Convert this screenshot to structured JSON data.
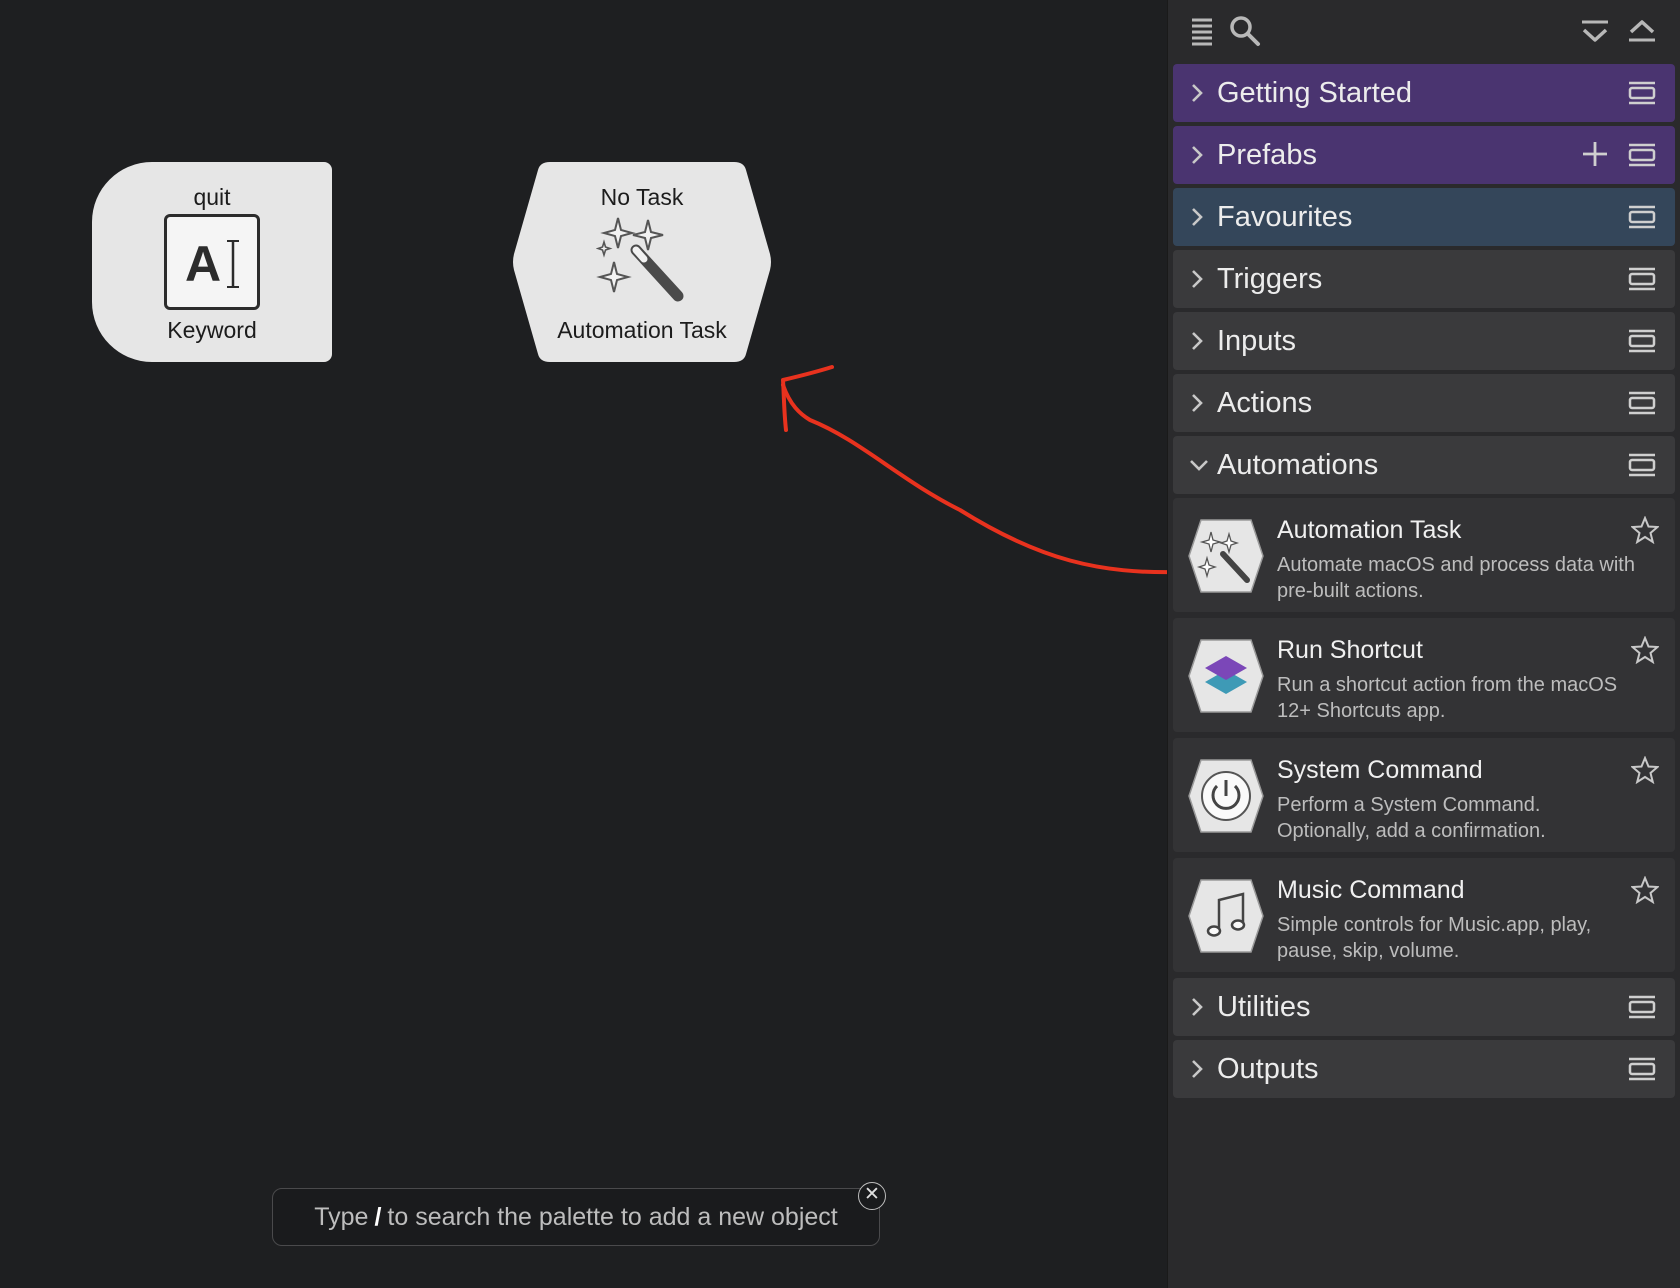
{
  "canvas": {
    "keyword_node": {
      "top_label": "quit",
      "bottom_label": "Keyword",
      "icon": "keyword-icon"
    },
    "task_node": {
      "top_label": "No Task",
      "bottom_label": "Automation Task",
      "icon": "magic-wand-icon"
    },
    "hint": {
      "prefix": "Type",
      "key": "/",
      "suffix": "to search the palette to add a new object"
    }
  },
  "sidebar": {
    "toolbar": {
      "left_icons": [
        "list-icon",
        "search-icon"
      ],
      "right_icons": [
        "collapse-all-icon",
        "expand-up-icon"
      ]
    },
    "sections_top": [
      {
        "label": "Getting Started",
        "color": "#4a3470"
      },
      {
        "label": "Prefabs",
        "color": "#4a3470",
        "has_add": true
      },
      {
        "label": "Favourites",
        "color": "#34465a"
      },
      {
        "label": "Triggers"
      },
      {
        "label": "Inputs"
      },
      {
        "label": "Actions"
      },
      {
        "label": "Automations",
        "expanded": true
      }
    ],
    "automation_items": [
      {
        "title": "Automation Task",
        "desc": "Automate macOS and process data with pre-built actions.",
        "icon": "magic-wand-icon"
      },
      {
        "title": "Run Shortcut",
        "desc": "Run a shortcut action from the macOS 12+ Shortcuts app.",
        "icon": "shortcuts-icon"
      },
      {
        "title": "System Command",
        "desc": "Perform a System Command. Optionally, add a confirmation.",
        "icon": "power-icon"
      },
      {
        "title": "Music Command",
        "desc": "Simple controls for Music.app, play, pause, skip, volume.",
        "icon": "music-note-icon"
      }
    ],
    "sections_bottom": [
      {
        "label": "Utilities"
      },
      {
        "label": "Outputs"
      }
    ]
  },
  "annotation": {
    "color": "#e8321e",
    "note": ""
  }
}
